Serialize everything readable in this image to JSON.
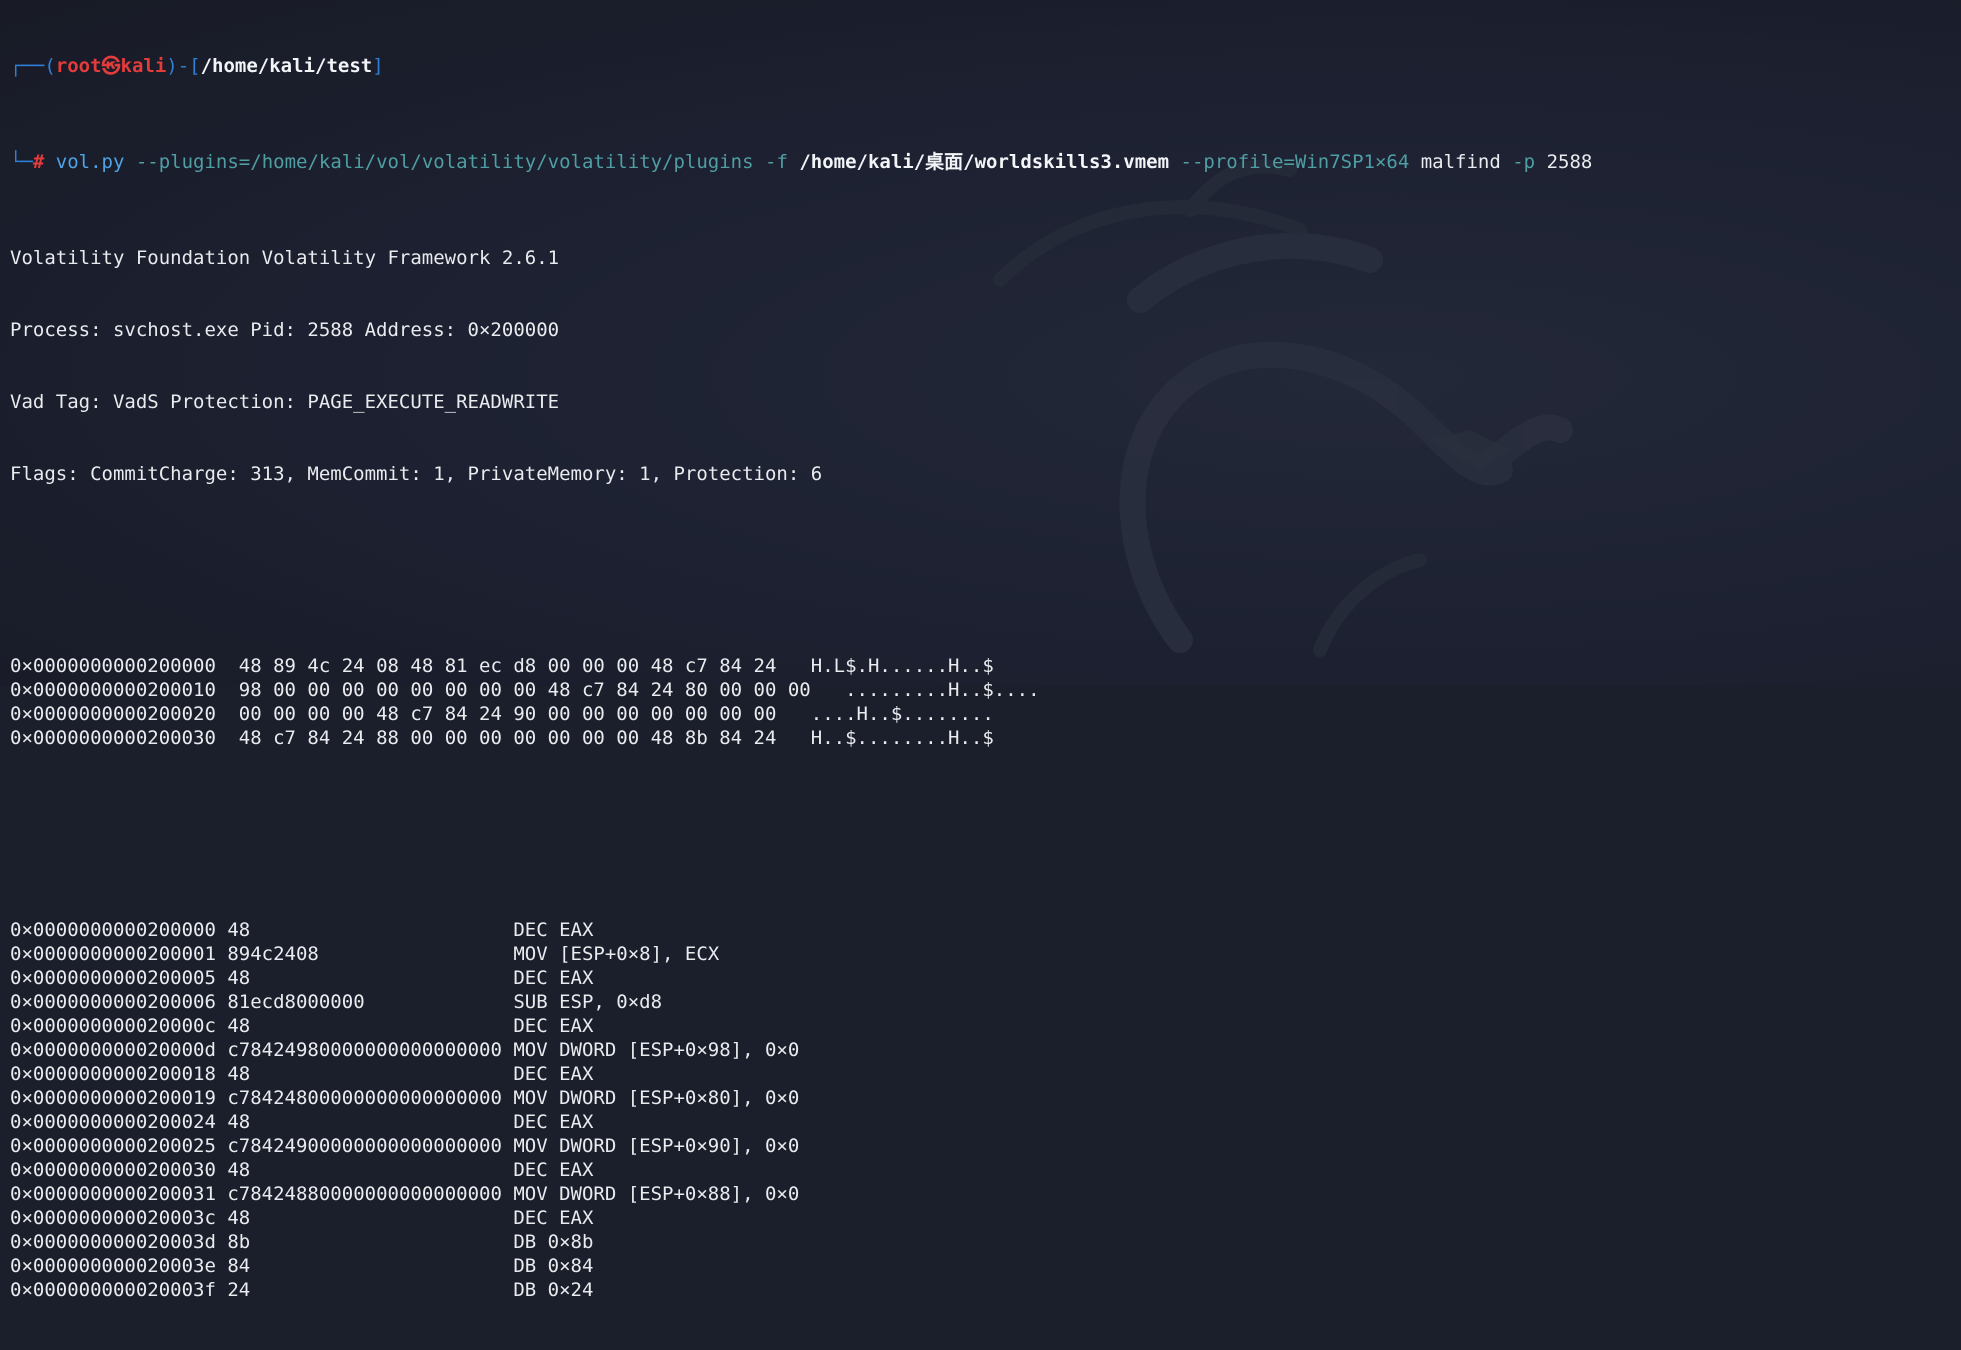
{
  "prompt": {
    "frame_top": "┌──(",
    "user": "root㉿kali",
    "frame_mid": ")-[",
    "path": "/home/kali/test",
    "frame_end": "]",
    "frame_bottom": "└─",
    "hash": "# "
  },
  "command": {
    "program": "vol.py",
    "plugins_flag": " --plugins=/home/kali/vol/volatility/volatility/plugins -f ",
    "file": "/home/kali/桌面/worldskills3.vmem",
    "profile_flag": " --profile=Win7SP1×64",
    "plugin": " malfind",
    "pid_flag": " -p",
    "pid": " 2588"
  },
  "header_lines": [
    "Volatility Foundation Volatility Framework 2.6.1",
    "Process: svchost.exe Pid: 2588 Address: 0×200000",
    "Vad Tag: VadS Protection: PAGE_EXECUTE_READWRITE",
    "Flags: CommitCharge: 313, MemCommit: 1, PrivateMemory: 1, Protection: 6"
  ],
  "hexdump": [
    {
      "address": "0×0000000000200000",
      "bytes": "48 89 4c 24 08 48 81 ec d8 00 00 00 48 c7 84 24",
      "ascii": "H.L$.H......H..$"
    },
    {
      "address": "0×0000000000200010",
      "bytes": "98 00 00 00 00 00 00 00 00 48 c7 84 24 80 00 00 00",
      "ascii": ".........H..$...."
    },
    {
      "address": "0×0000000000200020",
      "bytes": "00 00 00 00 48 c7 84 24 90 00 00 00 00 00 00 00",
      "ascii": "....H..$........"
    },
    {
      "address": "0×0000000000200030",
      "bytes": "48 c7 84 24 88 00 00 00 00 00 00 00 48 8b 84 24",
      "ascii": "H..$........H..$"
    }
  ],
  "disassembly": [
    {
      "address": "0×0000000000200000",
      "opcode": "48",
      "instruction": "DEC EAX"
    },
    {
      "address": "0×0000000000200001",
      "opcode": "894c2408",
      "instruction": "MOV [ESP+0×8], ECX"
    },
    {
      "address": "0×0000000000200005",
      "opcode": "48",
      "instruction": "DEC EAX"
    },
    {
      "address": "0×0000000000200006",
      "opcode": "81ecd8000000",
      "instruction": "SUB ESP, 0×d8"
    },
    {
      "address": "0×000000000020000c",
      "opcode": "48",
      "instruction": "DEC EAX"
    },
    {
      "address": "0×000000000020000d",
      "opcode": "c78424980000000000000000",
      "instruction": "MOV DWORD [ESP+0×98], 0×0"
    },
    {
      "address": "0×0000000000200018",
      "opcode": "48",
      "instruction": "DEC EAX"
    },
    {
      "address": "0×0000000000200019",
      "opcode": "c78424800000000000000000",
      "instruction": "MOV DWORD [ESP+0×80], 0×0"
    },
    {
      "address": "0×0000000000200024",
      "opcode": "48",
      "instruction": "DEC EAX"
    },
    {
      "address": "0×0000000000200025",
      "opcode": "c78424900000000000000000",
      "instruction": "MOV DWORD [ESP+0×90], 0×0"
    },
    {
      "address": "0×0000000000200030",
      "opcode": "48",
      "instruction": "DEC EAX"
    },
    {
      "address": "0×0000000000200031",
      "opcode": "c78424880000000000000000",
      "instruction": "MOV DWORD [ESP+0×88], 0×0"
    },
    {
      "address": "0×000000000020003c",
      "opcode": "48",
      "instruction": "DEC EAX"
    },
    {
      "address": "0×000000000020003d",
      "opcode": "8b",
      "instruction": "DB 0×8b"
    },
    {
      "address": "0×000000000020003e",
      "opcode": "84",
      "instruction": "DB 0×84"
    },
    {
      "address": "0×000000000020003f",
      "opcode": "24",
      "instruction": "DB 0×24"
    }
  ],
  "colors": {
    "background": "#1b1f2b",
    "prompt_frame": "#2f7fd6",
    "prompt_user": "#e43b3b",
    "command": "#4fa3e6",
    "flag": "#4f9ea4",
    "text": "#e9ebee"
  },
  "background_icon": "kali-dragon-icon"
}
